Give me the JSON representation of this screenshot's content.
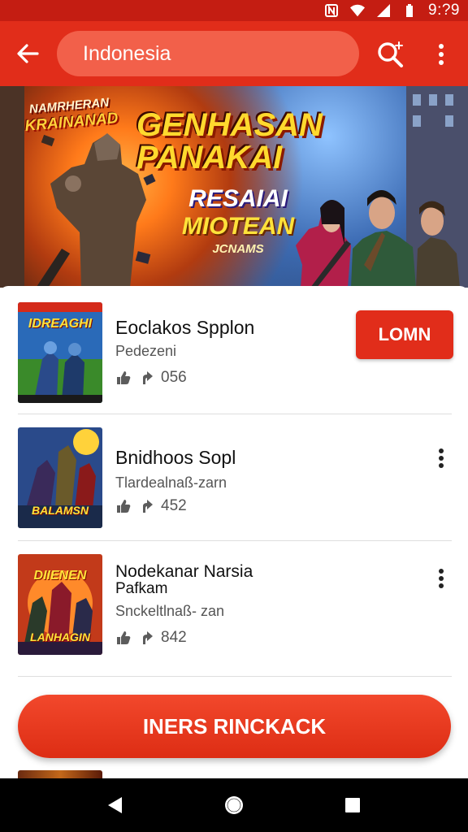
{
  "status_bar": {
    "time": "9:?9",
    "icons": [
      "n-notification-icon",
      "wifi-icon",
      "signal-icon",
      "battery-icon"
    ]
  },
  "app_bar": {
    "back_icon": "arrow-left-icon",
    "search_text": "Indonesia",
    "search_icon": "search-sparkle-icon",
    "menu_icon": "more-vertical-icon"
  },
  "banner": {
    "corner_line1": "NAMRHERAN",
    "corner_line2": "KRAINANAD",
    "title": "GENHASAN PANAKAI",
    "subtitle_line1": "RESAIAI",
    "subtitle_line2": "MIOTEAN",
    "subtitle_line3": "JCNAMS"
  },
  "items": [
    {
      "title": "Eoclakos Spplon",
      "title_line2": "",
      "subtitle": "Pedezeni",
      "count": "056",
      "thumb_top": "IDREAGHI",
      "thumb_bottom": "",
      "action_label": "LOMN"
    },
    {
      "title": "Bnidhoos Sopl",
      "title_line2": "",
      "subtitle": "Tlardealnaß-zarn",
      "count": "452",
      "thumb_top": "",
      "thumb_bottom": "BALAMSN"
    },
    {
      "title": "Nodekanar Narsia",
      "title_line2": "Pafkam",
      "subtitle": "Snckeltlnaß- zan",
      "count": "842",
      "thumb_top": "DIIENEN",
      "thumb_bottom": "LANHAGIN"
    }
  ],
  "cta": {
    "label": "INERS RINCKACK"
  },
  "colors": {
    "primary_red": "#e12d1a",
    "status_red": "#c41d12",
    "search_pill": "#f2604a"
  }
}
